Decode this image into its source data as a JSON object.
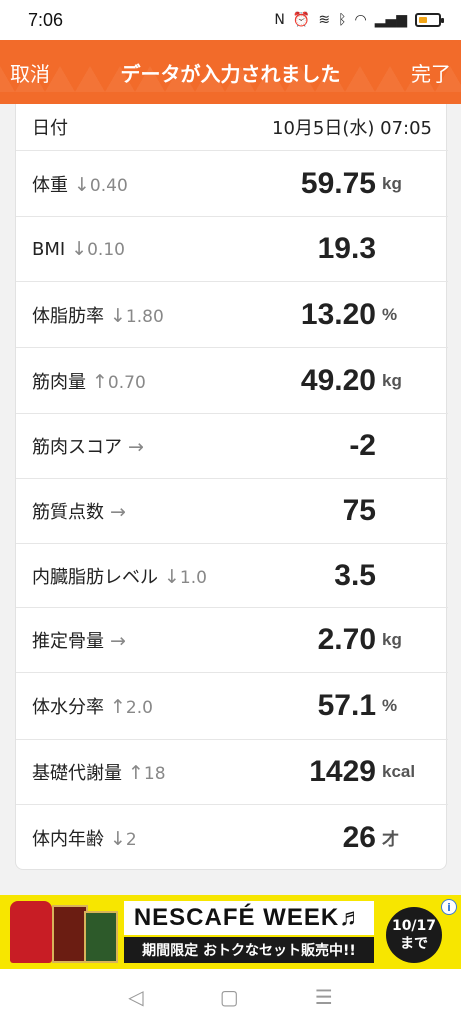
{
  "status_bar": {
    "time": "7:06",
    "icons": [
      "nfc-icon",
      "alarm-icon",
      "vibrate-icon",
      "bluetooth-icon",
      "wifi-icon",
      "signal-icon",
      "battery-icon"
    ]
  },
  "header": {
    "cancel_label": "取消",
    "title": "データが入力されました",
    "done_label": "完了",
    "color": "#f26b2a"
  },
  "date_row": {
    "label": "日付",
    "value": "10月5日(水) 07:05"
  },
  "rows": [
    {
      "label": "体重",
      "arrow": "↓",
      "delta": "0.40",
      "value": "59.75",
      "unit": "kg"
    },
    {
      "label": "BMI",
      "arrow": "↓",
      "delta": "0.10",
      "value": "19.3",
      "unit": ""
    },
    {
      "label": "体脂肪率",
      "arrow": "↓",
      "delta": "1.80",
      "value": "13.20",
      "unit": "%"
    },
    {
      "label": "筋肉量",
      "arrow": "↑",
      "delta": "0.70",
      "value": "49.20",
      "unit": "kg"
    },
    {
      "label": "筋肉スコア",
      "arrow": "→",
      "delta": "",
      "value": "-2",
      "unit": ""
    },
    {
      "label": "筋質点数",
      "arrow": "→",
      "delta": "",
      "value": "75",
      "unit": ""
    },
    {
      "label": "内臓脂肪レベル",
      "arrow": "↓",
      "delta": "1.0",
      "value": "3.5",
      "unit": ""
    },
    {
      "label": "推定骨量",
      "arrow": "→",
      "delta": "",
      "value": "2.70",
      "unit": "kg"
    },
    {
      "label": "体水分率",
      "arrow": "↑",
      "delta": "2.0",
      "value": "57.1",
      "unit": "%"
    },
    {
      "label": "基礎代謝量",
      "arrow": "↑",
      "delta": "18",
      "value": "1429",
      "unit": "kcal"
    },
    {
      "label": "体内年齢",
      "arrow": "↓",
      "delta": "2",
      "value": "26",
      "unit": "才"
    }
  ],
  "ad": {
    "brand": "NESCAFÉ WEEK♬",
    "sale_text": "期間限定 おトクなセット販売中!!",
    "badge_date": "10/17",
    "badge_until": "まで",
    "info_symbol": "i"
  },
  "navbar": {
    "back": "◁",
    "home": "▢",
    "recents": "☰"
  }
}
